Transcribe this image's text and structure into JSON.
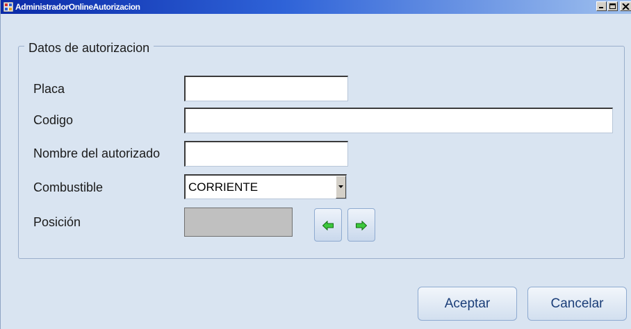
{
  "window": {
    "title": "AdministradorOnlineAutorizacion",
    "controls": [
      "minimize",
      "maximize",
      "close"
    ]
  },
  "form": {
    "group_title": "Datos de autorizacion",
    "fields": {
      "placa": {
        "label": "Placa",
        "value": ""
      },
      "codigo": {
        "label": "Codigo",
        "value": ""
      },
      "nombre": {
        "label": "Nombre del autorizado",
        "value": ""
      },
      "combustible": {
        "label": "Combustible",
        "selected": "CORRIENTE"
      },
      "posicion": {
        "label": "Posición",
        "value": ""
      }
    },
    "nav": {
      "prev_icon": "green-left-arrow-icon",
      "next_icon": "green-right-arrow-icon"
    }
  },
  "actions": {
    "accept": "Aceptar",
    "cancel": "Cancelar"
  },
  "colors": {
    "window_bg": "#d9e4f1",
    "title_gradient_start": "#0a2aa8",
    "button_text": "#1a3d78",
    "arrow_green": "#3cc83c"
  }
}
